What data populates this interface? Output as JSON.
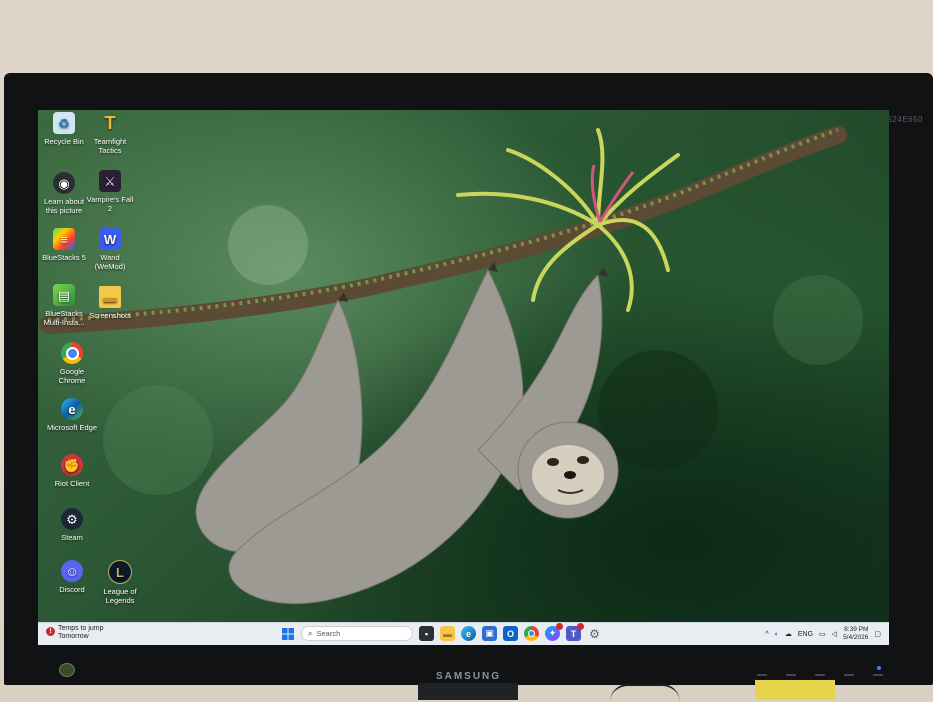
{
  "monitor": {
    "model_label": "S24E650",
    "brand": "SAMSUNG"
  },
  "desktop_icons": [
    {
      "label": "Recycle Bin",
      "icon": "recycle-bin-icon"
    },
    {
      "label": "Teamfight Tactics",
      "icon": "teamfight-tactics-icon"
    },
    {
      "label": "Learn about this picture",
      "icon": "learn-about-picture-icon"
    },
    {
      "label": "Vampire's Fall 2",
      "icon": "vampires-fall-icon"
    },
    {
      "label": "BlueStacks 5",
      "icon": "bluestacks-icon"
    },
    {
      "label": "Wand (WeMod)",
      "icon": "wand-icon"
    },
    {
      "label": "BlueStacks Multi-Insta...",
      "icon": "bluestacks-multi-icon"
    },
    {
      "label": "Screenshots",
      "icon": "folder-icon"
    },
    {
      "label": "Google Chrome",
      "icon": "chrome-icon"
    },
    {
      "label": "Microsoft Edge",
      "icon": "edge-icon"
    },
    {
      "label": "Riot Client",
      "icon": "riot-client-icon"
    },
    {
      "label": "Steam",
      "icon": "steam-icon"
    },
    {
      "label": "Discord",
      "icon": "discord-icon"
    },
    {
      "label": "League of Legends",
      "icon": "league-of-legends-icon"
    }
  ],
  "taskbar": {
    "weather_line1": "Temps to jump",
    "weather_line2": "Tomorrow",
    "weather_alert": "!",
    "search_placeholder": "Search",
    "pinned_icons": [
      "windows-start-icon",
      "search-icon",
      "task-view-icon",
      "file-explorer-icon",
      "edge-icon",
      "store-icon",
      "outlook-icon",
      "chrome-icon",
      "messenger-icon",
      "teams-icon",
      "settings-icon"
    ],
    "tray_language": "ENG",
    "time": "8:39 PM",
    "date": "5/4/2026"
  },
  "colors": {
    "taskbar_bg": "#e9edf2",
    "accent_blue": "#1a73e8",
    "alert_red": "#d3262e"
  }
}
